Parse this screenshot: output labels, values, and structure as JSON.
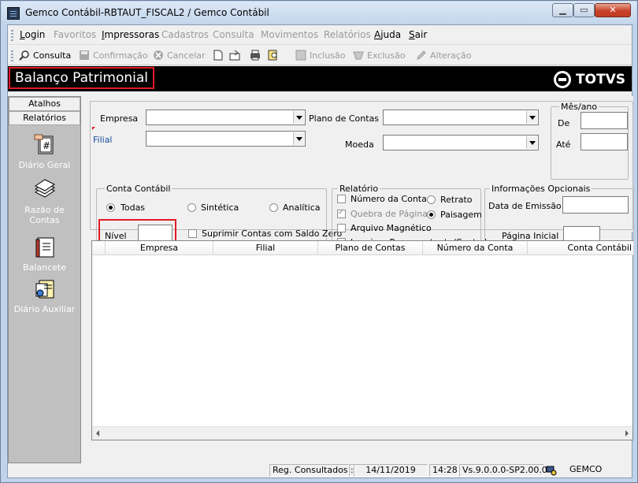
{
  "window": {
    "title": "Gemco Contábil-RBTAUT_FISCAL2 / Gemco Contábil",
    "min": "▁",
    "max": "▭",
    "close": "✕"
  },
  "menu": [
    {
      "label": "Login",
      "enabled": true
    },
    {
      "label": "Favoritos",
      "enabled": false
    },
    {
      "label": "Impressoras",
      "enabled": true
    },
    {
      "label": "Cadastros",
      "enabled": false
    },
    {
      "label": "Consulta",
      "enabled": false
    },
    {
      "label": "Movimentos",
      "enabled": false
    },
    {
      "label": "Relatórios",
      "enabled": false
    },
    {
      "label": "Ajuda",
      "enabled": true
    },
    {
      "label": "Sair",
      "enabled": true
    }
  ],
  "toolbar": {
    "consulta": "Consulta",
    "confirmacao": "Confirmação",
    "cancelar": "Cancelar",
    "inclusao": "Inclusão",
    "exclusao": "Exclusão",
    "alteracao": "Alteração"
  },
  "header": {
    "page_title": "Balanço Patrimonial",
    "logo": "TOTVS"
  },
  "sidebar": {
    "tabs": [
      "Atalhos",
      "Relatórios"
    ],
    "items": [
      {
        "label": "Diário Geral",
        "icon": "diario-geral-icon"
      },
      {
        "label": "Razão de Contas",
        "icon": "razao-contas-icon"
      },
      {
        "label": "Balancete",
        "icon": "balancete-icon"
      },
      {
        "label": "Diário Auxiliar",
        "icon": "diario-auxiliar-icon"
      }
    ]
  },
  "form": {
    "empresa_label": "Empresa",
    "filial_label": "Filial",
    "plano_label": "Plano de Contas",
    "moeda_label": "Moeda",
    "mesano_group": "Mês/ano",
    "de_label": "De",
    "ate_label": "Até",
    "conta_group": "Conta Contábil",
    "todas": "Todas",
    "sintetica": "Sintética",
    "analitica": "Analítica",
    "nivel_label": "Nível",
    "suprimir_label": "Suprimir Contas com Saldo Zero",
    "relatorio_group": "Relatório",
    "numero_conta": "Número da Conta",
    "quebra_pagina": "Quebra de Página",
    "arquivo_magnetico": "Arquivo Magnético",
    "imprime_representante": "Imprime Representante/Contador",
    "retrato": "Retrato",
    "paisagem": "Paisagem",
    "info_group": "Informações Opcionais",
    "data_emissao_label": "Data de Emissão",
    "pagina_inicial_label": "Página Inicial"
  },
  "grid": {
    "columns": [
      "Empresa",
      "Filial",
      "Plano de Contas",
      "Número da Conta",
      "Conta Contábil"
    ]
  },
  "status": {
    "reg_label": "Reg. Consultados :",
    "reg_value": "",
    "date": "14/11/2019",
    "time": "14:28",
    "version": "Vs.9.0.0.0-SP2.00.0",
    "system": "GEMCO"
  },
  "colors": {
    "highlight": "#e01b24",
    "banner": "#000000",
    "sidebar": "#c0c0c0"
  }
}
